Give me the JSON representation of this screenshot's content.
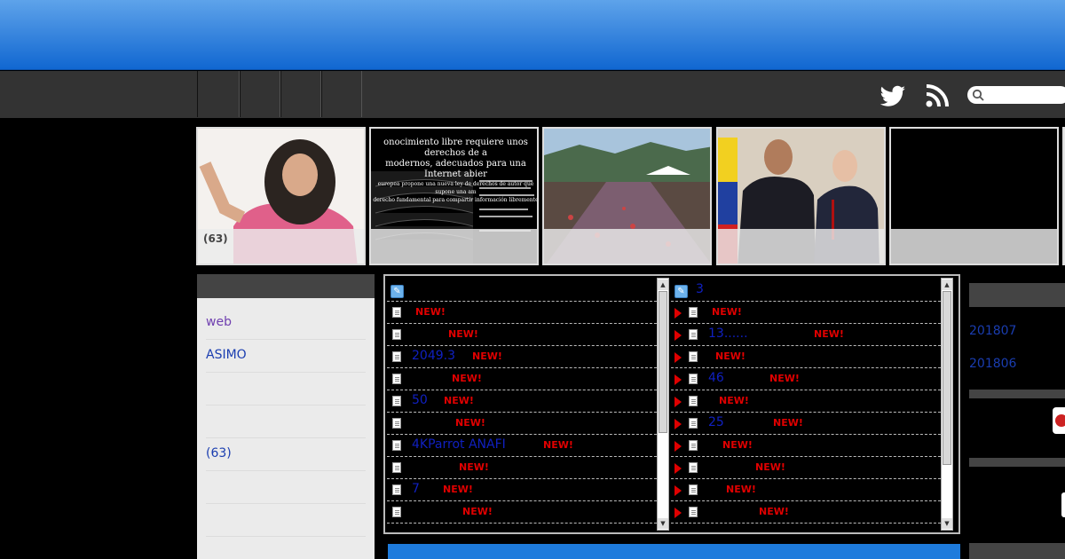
{
  "thumbnails": [
    {
      "caption": "(63)"
    },
    {
      "caption": "",
      "headline_lines": [
        "onocimiento libre requiere unos derechos de a",
        "modernos, adecuados para una Internet abier",
        "europea propone una nueva ley de derechos de autor que supone una am",
        "derecho fundamental para compartir información libremente"
      ]
    },
    {
      "caption": ""
    },
    {
      "caption": ""
    },
    {
      "caption": ""
    }
  ],
  "sidebar_left": {
    "items": [
      "web",
      "ASIMO",
      "",
      "",
      "(63)",
      "",
      ""
    ]
  },
  "feed_left": {
    "rows": [
      {
        "text": "",
        "new": "NEW!"
      },
      {
        "text": "",
        "new": "NEW!"
      },
      {
        "text": "2049.3",
        "new": "NEW!"
      },
      {
        "text": "",
        "new": "NEW!"
      },
      {
        "text": "50",
        "new": "NEW!"
      },
      {
        "text": "",
        "new": "NEW!"
      },
      {
        "text": "4KParrot ANAFI",
        "new": "NEW!"
      },
      {
        "text": "",
        "new": "NEW!"
      },
      {
        "text": "7",
        "new": "NEW!"
      },
      {
        "text": "",
        "new": "NEW!"
      }
    ]
  },
  "feed_right": {
    "header_count": "3",
    "rows": [
      {
        "text": "",
        "new": "NEW!"
      },
      {
        "text": "13......",
        "new": "NEW!"
      },
      {
        "text": "",
        "new": "NEW!"
      },
      {
        "text": "46",
        "new": "NEW!"
      },
      {
        "text": "",
        "new": "NEW!"
      },
      {
        "text": "25",
        "new": "NEW!"
      },
      {
        "text": "",
        "new": "NEW!"
      },
      {
        "text": "",
        "new": "NEW!"
      },
      {
        "text": "",
        "new": "NEW!"
      },
      {
        "text": "",
        "new": "NEW!"
      }
    ]
  },
  "sidebar_right": {
    "archives": [
      "201807",
      "201806"
    ]
  },
  "icons": {
    "twitter": "twitter-icon",
    "rss": "rss-icon",
    "search": "search-icon"
  },
  "colors": {
    "banner_top": "#5ea3ea",
    "banner_bottom": "#1167d1",
    "new_badge": "#e00000",
    "link": "#1a3db0"
  }
}
